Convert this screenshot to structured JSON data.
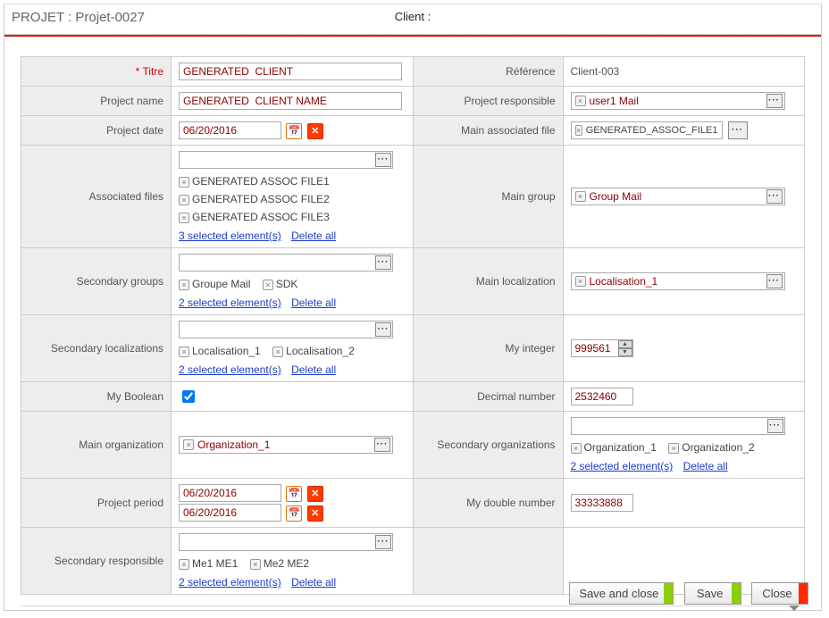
{
  "header": {
    "project_label_prefix": "PROJET : ",
    "project_code": "Projet-0027",
    "client_label": "Client :"
  },
  "labels": {
    "titre": "Titre",
    "project_name": "Project name",
    "project_date": "Project date",
    "associated_files": "Associated files",
    "secondary_groups": "Secondary groups",
    "secondary_localizations": "Secondary localizations",
    "my_boolean": "My Boolean",
    "main_organization": "Main organization",
    "project_period": "Project period",
    "secondary_responsible": "Secondary responsible",
    "reference": "Référence",
    "project_responsible": "Project responsible",
    "main_associated_file": "Main associated file",
    "main_group": "Main group",
    "main_localization": "Main localization",
    "my_integer": "My integer",
    "decimal_number": "Decimal number",
    "secondary_organizations": "Secondary organizations",
    "my_double_number": "My double number"
  },
  "values": {
    "titre": "GENERATED  CLIENT",
    "project_name": "GENERATED  CLIENT NAME",
    "project_date": "06/20/2016",
    "reference": "Client-003",
    "project_responsible": "user1 Mail",
    "main_associated_file": "GENERATED_ASSOC_FILE1",
    "main_group": "Group Mail",
    "main_localization": "Localisation_1",
    "my_integer": "999561",
    "decimal_number": "2532460",
    "main_organization": "Organization_1",
    "my_double_number": "33333888",
    "period_start": "06/20/2016",
    "period_end": "06/20/2016",
    "my_boolean": true
  },
  "associated_files": {
    "items": [
      "GENERATED  ASSOC  FILE1",
      "GENERATED  ASSOC  FILE2",
      "GENERATED  ASSOC  FILE3"
    ],
    "selected_text": "3 selected element(s)",
    "delete_all": "Delete all"
  },
  "secondary_groups": {
    "items": [
      "Groupe Mail",
      "SDK"
    ],
    "selected_text": "2 selected element(s)",
    "delete_all": "Delete all"
  },
  "secondary_localizations": {
    "items": [
      "Localisation_1",
      "Localisation_2"
    ],
    "selected_text": "2 selected element(s)",
    "delete_all": "Delete all"
  },
  "secondary_organizations": {
    "items": [
      "Organization_1",
      "Organization_2"
    ],
    "selected_text": "2 selected element(s)",
    "delete_all": "Delete all"
  },
  "secondary_responsible": {
    "items": [
      "Me1 ME1",
      "Me2 ME2"
    ],
    "selected_text": "2 selected element(s)",
    "delete_all": "Delete all"
  },
  "footer": {
    "save_and_close": "Save and close",
    "save": "Save",
    "close": "Close"
  }
}
